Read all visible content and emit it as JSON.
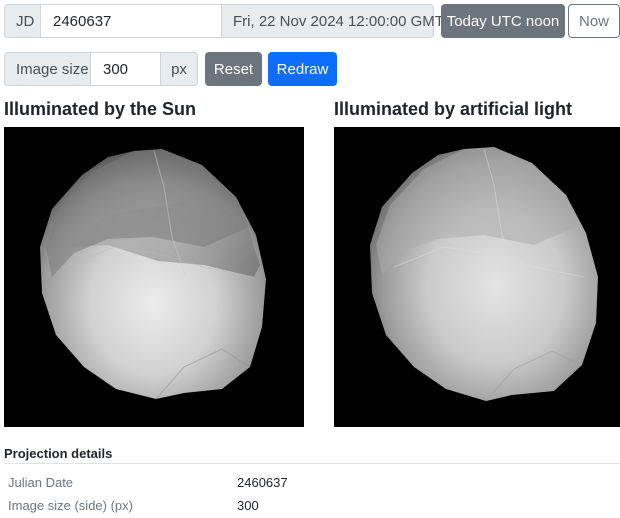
{
  "toolbar": {
    "jd_label": "JD",
    "jd_value": "2460637",
    "date_display": "Fri, 22 Nov 2024 12:00:00 GMT",
    "today_button": "Today UTC noon",
    "now_button": "Now"
  },
  "size_controls": {
    "label": "Image size",
    "value": "300",
    "unit": "px",
    "reset_button": "Reset",
    "redraw_button": "Redraw"
  },
  "views": [
    {
      "title": "Illuminated by the Sun",
      "image": "asteroid-shape-render-sunlit"
    },
    {
      "title": "Illuminated by artificial light",
      "image": "asteroid-shape-render-artificial"
    }
  ],
  "details": {
    "title": "Projection details",
    "rows": [
      {
        "label": "Julian Date",
        "value": "2460637"
      },
      {
        "label": "Image size (side) (px)",
        "value": "300"
      }
    ]
  },
  "colors": {
    "primary": "#0d6efd",
    "secondary": "#6c757d",
    "input_group_bg": "#e9ecef",
    "canvas_bg": "#000000"
  }
}
